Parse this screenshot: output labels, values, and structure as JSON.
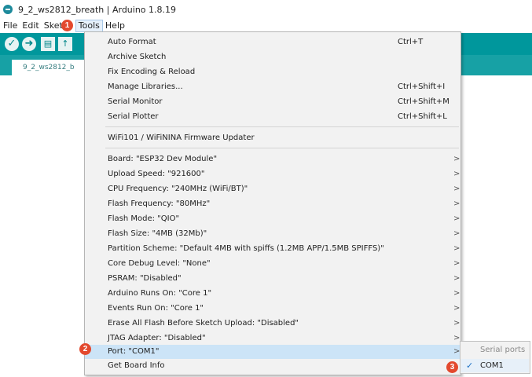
{
  "window": {
    "title": "9_2_ws2812_breath | Arduino 1.8.19"
  },
  "menubar": {
    "file": "File",
    "edit": "Edit",
    "sketch": "Sketch",
    "tools": "Tools",
    "help": "Help"
  },
  "toolbar": {
    "verify_icon": "check-icon",
    "upload_icon": "arrow-right-icon",
    "new_icon": "new-file-icon"
  },
  "tabs": [
    {
      "label": "9_2_ws2812_b"
    }
  ],
  "tools_menu": {
    "group1": [
      {
        "label": "Auto Format",
        "shortcut": "Ctrl+T"
      },
      {
        "label": "Archive Sketch",
        "shortcut": ""
      },
      {
        "label": "Fix Encoding & Reload",
        "shortcut": ""
      },
      {
        "label": "Manage Libraries...",
        "shortcut": "Ctrl+Shift+I"
      },
      {
        "label": "Serial Monitor",
        "shortcut": "Ctrl+Shift+M"
      },
      {
        "label": "Serial Plotter",
        "shortcut": "Ctrl+Shift+L"
      }
    ],
    "group2": [
      {
        "label": "WiFi101 / WiFiNINA Firmware Updater"
      }
    ],
    "group3": [
      {
        "label": "Board: \"ESP32 Dev Module\""
      },
      {
        "label": "Upload Speed: \"921600\""
      },
      {
        "label": "CPU Frequency: \"240MHz (WiFi/BT)\""
      },
      {
        "label": "Flash Frequency: \"80MHz\""
      },
      {
        "label": "Flash Mode: \"QIO\""
      },
      {
        "label": "Flash Size: \"4MB (32Mb)\""
      },
      {
        "label": "Partition Scheme: \"Default 4MB with spiffs (1.2MB APP/1.5MB SPIFFS)\""
      },
      {
        "label": "Core Debug Level: \"None\""
      },
      {
        "label": "PSRAM: \"Disabled\""
      },
      {
        "label": "Arduino Runs On: \"Core 1\""
      },
      {
        "label": "Events Run On: \"Core 1\""
      },
      {
        "label": "Erase All Flash Before Sketch Upload: \"Disabled\""
      },
      {
        "label": "JTAG Adapter: \"Disabled\""
      },
      {
        "label": "Port: \"COM1\""
      },
      {
        "label": "Get Board Info"
      }
    ],
    "submenu_arrow": ">"
  },
  "port_submenu": {
    "header": "Serial ports",
    "items": [
      {
        "label": "COM1",
        "checked": "✓"
      }
    ]
  },
  "annotations": {
    "step1": "1",
    "step2": "2",
    "step3": "3",
    "color": "#e3492e"
  }
}
